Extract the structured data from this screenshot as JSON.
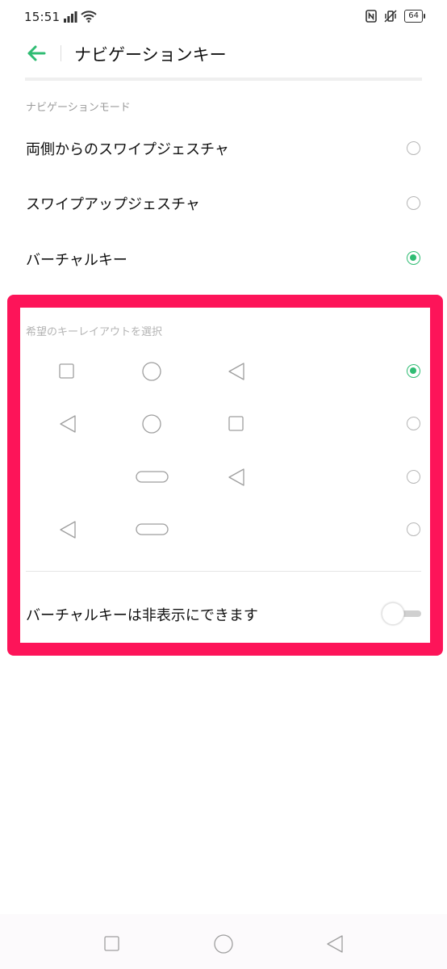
{
  "status_bar": {
    "time": "15:51",
    "battery": "64"
  },
  "header": {
    "title": "ナビゲーションキー"
  },
  "navigation_mode": {
    "section_label": "ナビゲーションモード",
    "options": [
      {
        "label": "両側からのスワイプジェスチャ",
        "selected": false
      },
      {
        "label": "スワイプアップジェスチャ",
        "selected": false
      },
      {
        "label": "バーチャルキー",
        "selected": true
      }
    ]
  },
  "key_layout": {
    "section_label": "希望のキーレイアウトを選択",
    "layouts": [
      {
        "keys": [
          "square-icon",
          "circle-icon",
          "back-triangle-icon"
        ],
        "selected": true
      },
      {
        "keys": [
          "back-triangle-icon",
          "circle-icon",
          "square-icon"
        ],
        "selected": false
      },
      {
        "keys": [
          "pill-icon",
          "back-triangle-icon"
        ],
        "selected": false
      },
      {
        "keys": [
          "back-triangle-icon",
          "pill-icon"
        ],
        "selected": false
      }
    ]
  },
  "hide_keys": {
    "label": "バーチャルキーは非表示にできます",
    "enabled": false
  },
  "colors": {
    "accent": "#2fbc73",
    "highlight": "#fd1459"
  }
}
